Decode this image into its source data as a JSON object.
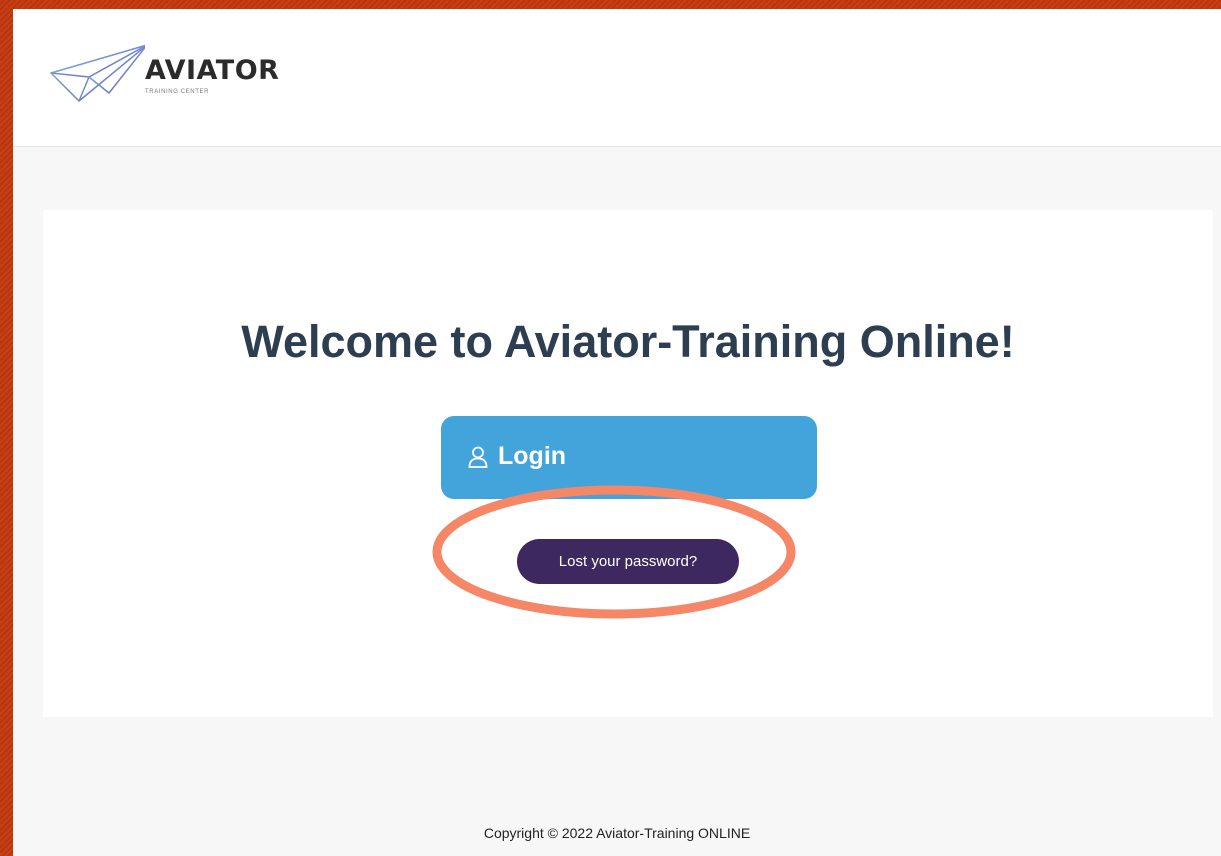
{
  "header": {
    "logo_word": "AVIATOR",
    "logo_sub": "TRAINING CENTER"
  },
  "main": {
    "welcome_title": "Welcome to Aviator-Training Online!",
    "login_button": {
      "label": "Login",
      "icon": "user-icon"
    },
    "lost_password_button": {
      "label": "Lost your password?"
    }
  },
  "footer": {
    "copyright": "Copyright © 2022 Aviator-Training ONLINE"
  },
  "colors": {
    "login_button": "#43a3db",
    "lost_password_button": "#3d2960",
    "title": "#2c3e50",
    "highlight_annotation": "#f58766",
    "background": "#c2360c"
  }
}
